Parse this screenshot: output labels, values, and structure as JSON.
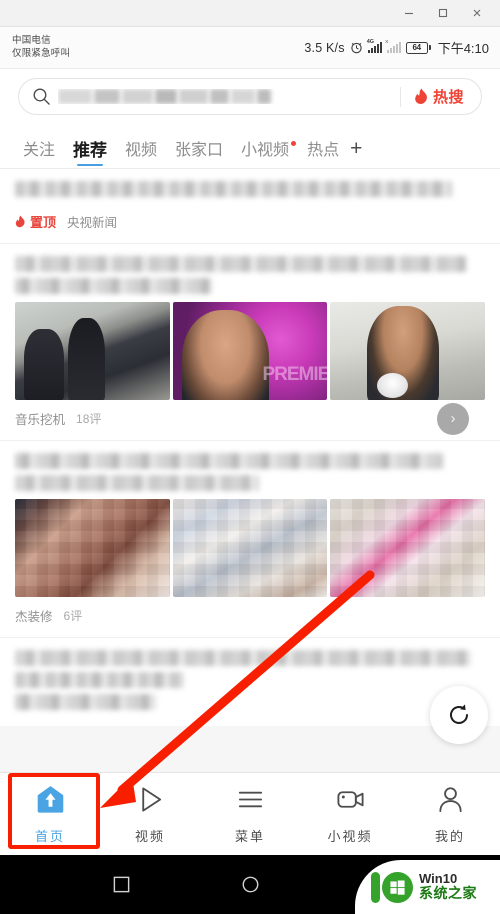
{
  "window": {
    "minimize_label": "minimize",
    "maximize_label": "maximize",
    "close_label": "close"
  },
  "statusbar": {
    "carrier_line1": "中国电信",
    "carrier_line2": "仅限紧急呼叫",
    "network_speed": "3.5 K/s",
    "signal_label": "4G",
    "battery_level": "64",
    "clock": "下午4:10"
  },
  "search": {
    "placeholder": "",
    "value": "",
    "hot_search_label": "热搜"
  },
  "tabs": [
    {
      "label": "关注",
      "active": false,
      "badge": false
    },
    {
      "label": "推荐",
      "active": true,
      "badge": false
    },
    {
      "label": "视频",
      "active": false,
      "badge": false
    },
    {
      "label": "张家口",
      "active": false,
      "badge": false
    },
    {
      "label": "小视频",
      "active": false,
      "badge": true
    },
    {
      "label": "热点",
      "active": false,
      "badge": false
    }
  ],
  "tab_add_label": "+",
  "feed": [
    {
      "pin_label": "置顶",
      "source": "央视新闻",
      "comments": "",
      "has_images": false
    },
    {
      "pin_label": "",
      "source": "音乐挖机",
      "comments": "18评",
      "has_images": true
    },
    {
      "pin_label": "",
      "source": "杰装修",
      "comments": "6评",
      "has_images": true
    }
  ],
  "chevron_label": "›",
  "refresh_label": "refresh",
  "bottom_nav": [
    {
      "label": "首页",
      "icon": "home-icon",
      "active": true
    },
    {
      "label": "视频",
      "icon": "play-icon",
      "active": false
    },
    {
      "label": "菜单",
      "icon": "menu-icon",
      "active": false
    },
    {
      "label": "小视频",
      "icon": "video-camera-icon",
      "active": false
    },
    {
      "label": "我的",
      "icon": "person-icon",
      "active": false
    }
  ],
  "android_nav": {
    "recents_label": "recents",
    "home_label": "home",
    "back_label": "back"
  },
  "watermark": {
    "line1": "Win10",
    "line2": "系统之家"
  },
  "colors": {
    "accent_blue": "#4aa3e3",
    "hot_red": "#ef4336",
    "pin_red": "#e8453c",
    "annotation_red": "#f81f00",
    "watermark_green": "#35a32b"
  }
}
